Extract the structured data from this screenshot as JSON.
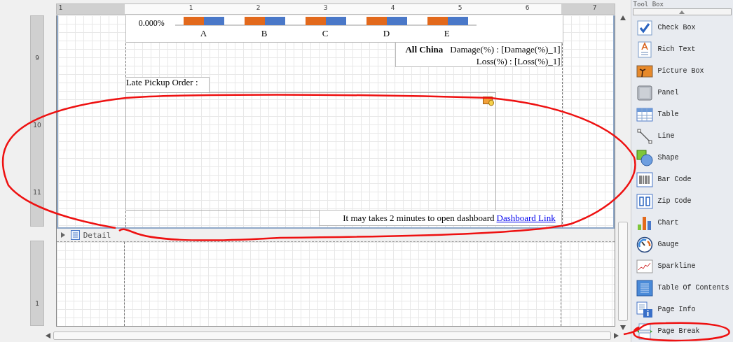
{
  "top_ruler": {
    "labels": [
      "1",
      "1",
      "2",
      "3",
      "4",
      "5",
      "6",
      "7"
    ]
  },
  "side_ruler": {
    "labels": [
      "9",
      "10",
      "11"
    ],
    "detail_labels": [
      "1"
    ]
  },
  "chart": {
    "tick_label": "0.000%",
    "categories": [
      "A",
      "B",
      "C",
      "D",
      "E"
    ]
  },
  "summary": {
    "title": "All China",
    "lines": [
      "Damage(%) : [Damage(%)_1]",
      "Loss(%) : [Loss(%)_1]"
    ]
  },
  "late_pickup_label": "Late Pickup Order :",
  "footer": {
    "text": "It may takes 2 minutes to open dashboard",
    "link": "Dashboard Link"
  },
  "detail_band": {
    "label": "Detail",
    "expanded": false
  },
  "toolbox": {
    "title": "Tool Box",
    "items": [
      {
        "label": "Check Box",
        "kind": "checkbox"
      },
      {
        "label": "Rich Text",
        "kind": "richtext"
      },
      {
        "label": "Picture Box",
        "kind": "picture"
      },
      {
        "label": "Panel",
        "kind": "panel"
      },
      {
        "label": "Table",
        "kind": "table"
      },
      {
        "label": "Line",
        "kind": "line"
      },
      {
        "label": "Shape",
        "kind": "shape"
      },
      {
        "label": "Bar Code",
        "kind": "barcode"
      },
      {
        "label": "Zip Code",
        "kind": "zipcode"
      },
      {
        "label": "Chart",
        "kind": "chart"
      },
      {
        "label": "Gauge",
        "kind": "gauge"
      },
      {
        "label": "Sparkline",
        "kind": "sparkline"
      },
      {
        "label": "Table Of Contents",
        "kind": "toc"
      },
      {
        "label": "Page Info",
        "kind": "pageinfo"
      },
      {
        "label": "Page Break",
        "kind": "pagebreak"
      }
    ]
  }
}
